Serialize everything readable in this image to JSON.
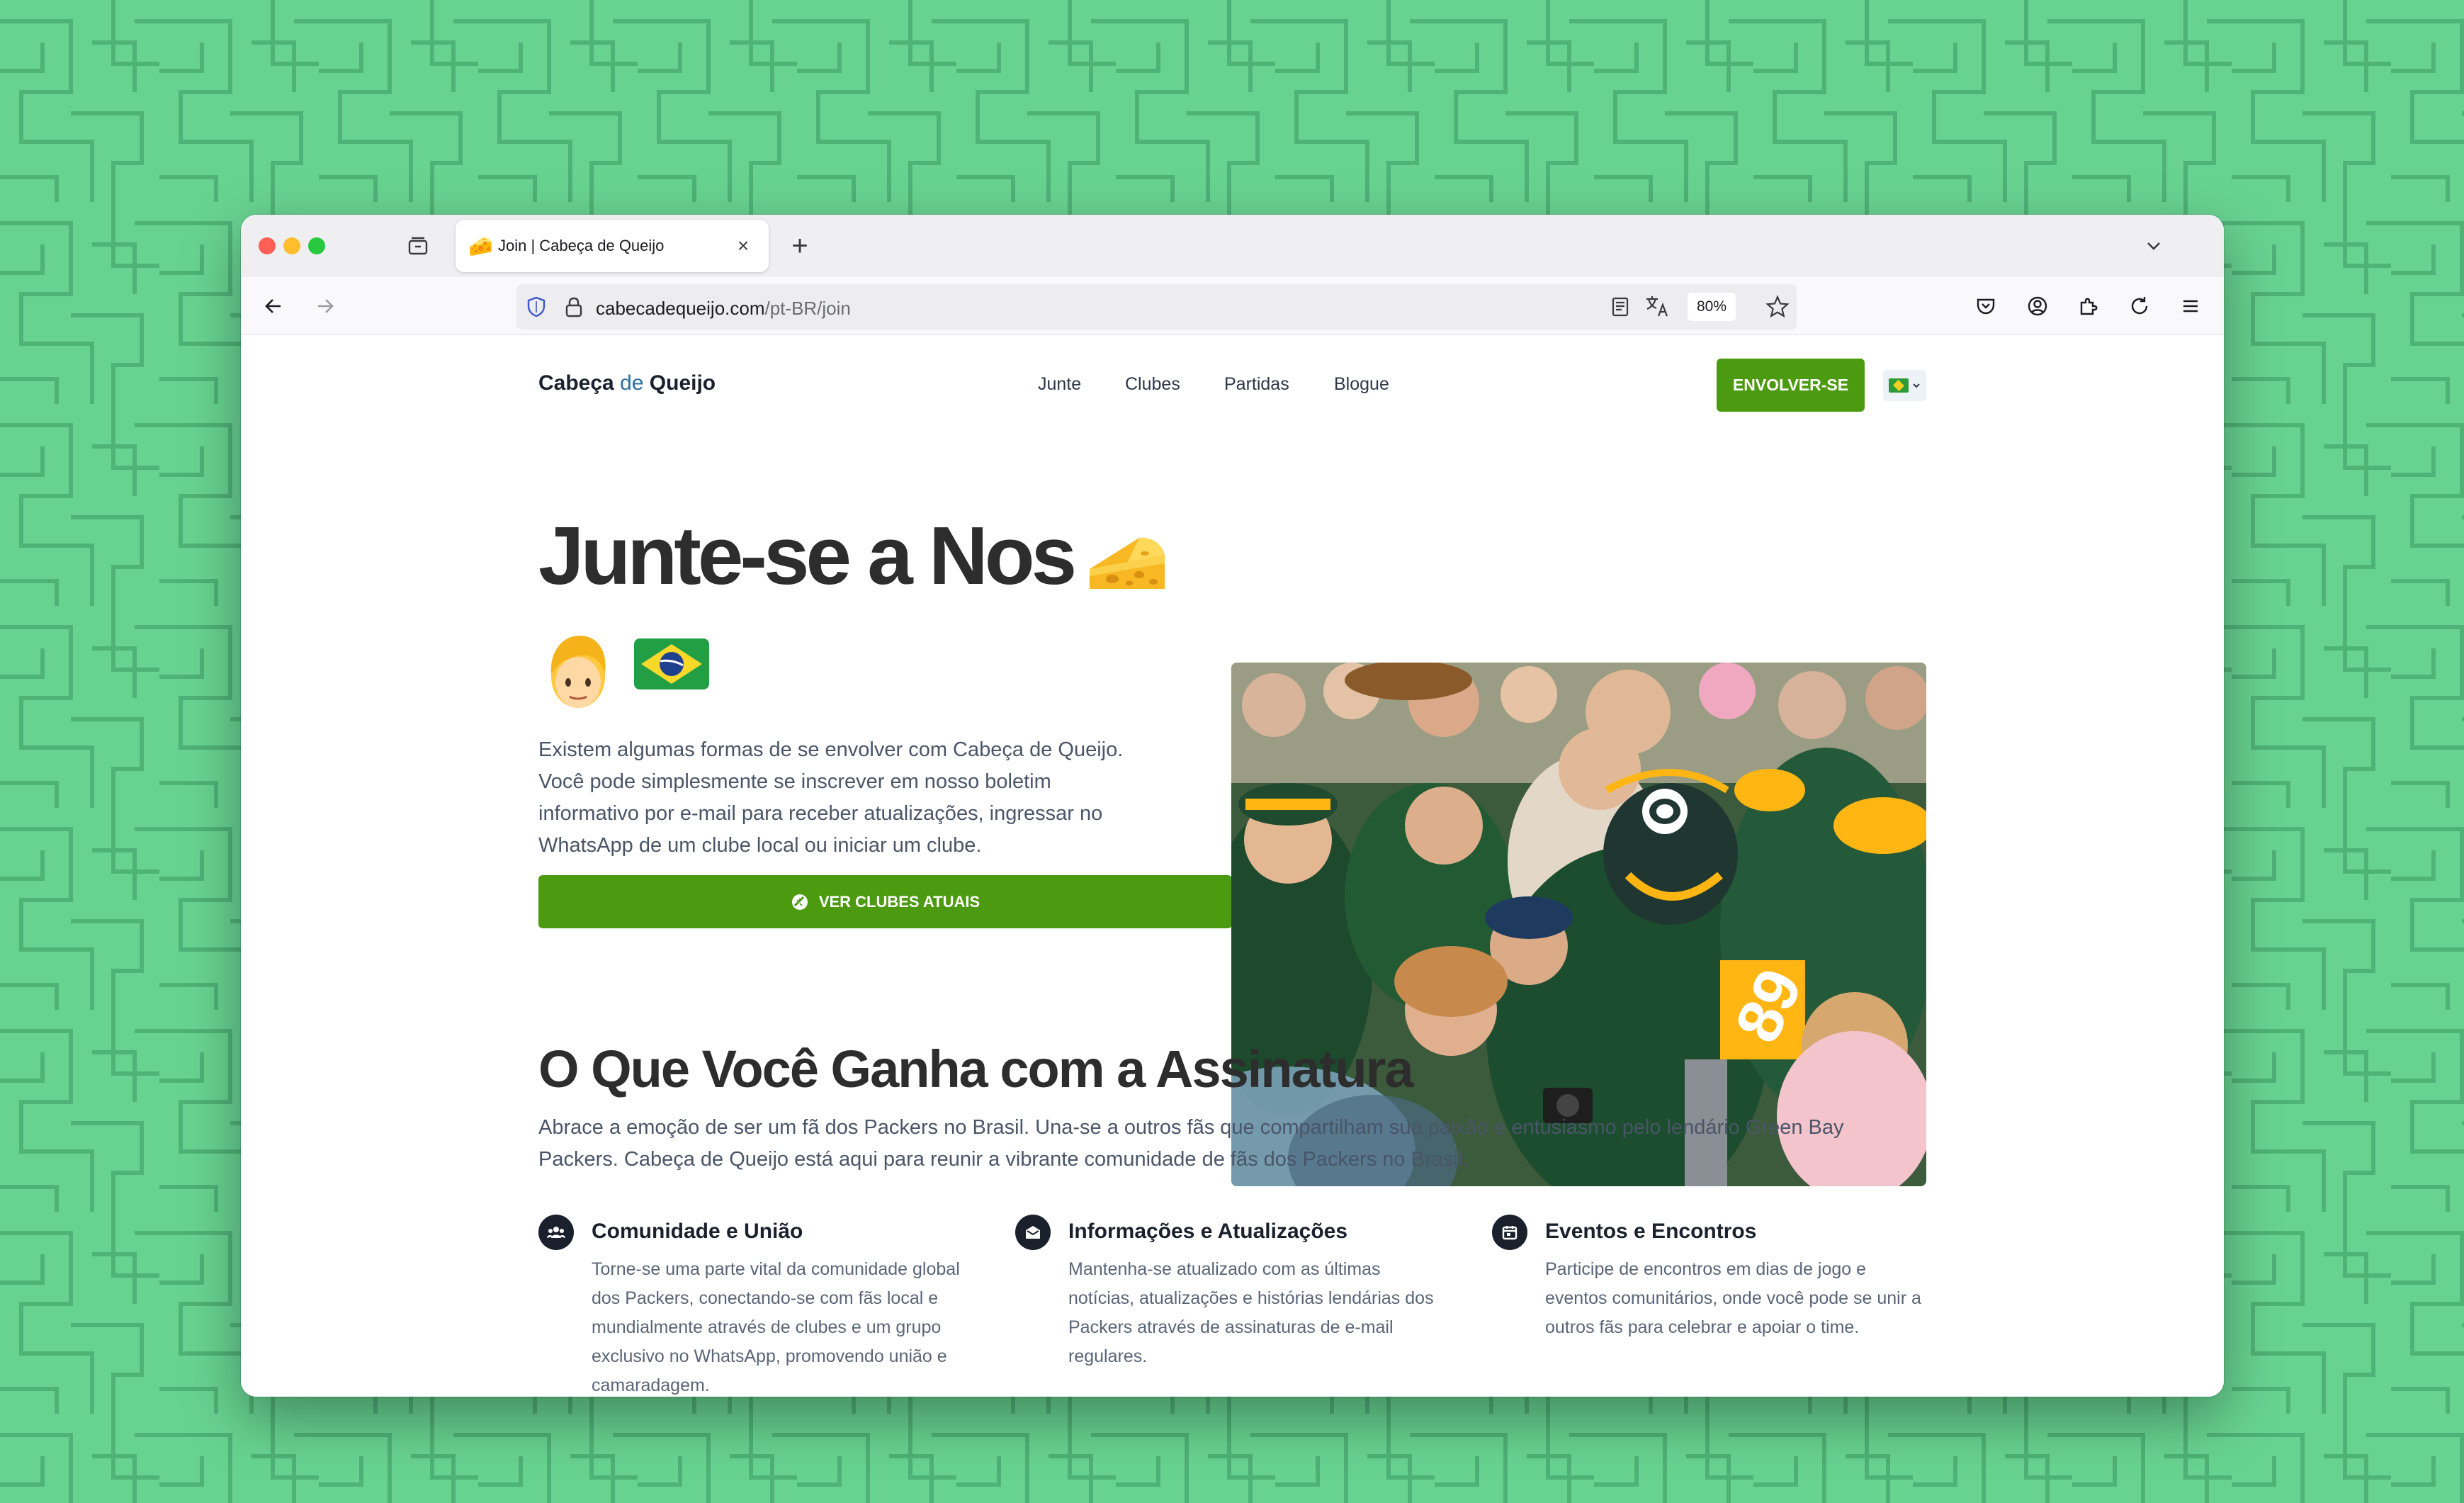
{
  "browser": {
    "tab": {
      "favicon": "🧀",
      "title": "Join | Cabeça de Queijo",
      "close": "×"
    },
    "new_tab": "+",
    "url": {
      "host": "cabecadequeijo.com",
      "path": "/pt-BR/join"
    },
    "zoom": "80%",
    "icons": {
      "back": "arrow-left-icon",
      "forward": "arrow-right-icon",
      "shield": "shield-icon",
      "lock": "lock-icon",
      "reader": "reader-view-icon",
      "translate": "translate-icon",
      "bookmark": "star-icon",
      "pocket": "pocket-icon",
      "account": "account-icon",
      "extensions": "extensions-icon",
      "reload": "reload-icon",
      "menu": "hamburger-menu-icon",
      "sidebar": "sidebar-tabs-icon",
      "tab_list": "chevron-down-icon"
    }
  },
  "site": {
    "brand": {
      "part1": "Cabeça",
      "part2": "de",
      "part3": "Queijo"
    },
    "nav": [
      "Junte",
      "Clubes",
      "Partidas",
      "Blogue"
    ],
    "cta": "ENVOLVER-SE",
    "language": "pt-BR flag"
  },
  "hero": {
    "title": "Junte-se a Nos",
    "emoji_cheese": "🧀",
    "emoji_person": "👱",
    "emoji_flag": "🇧🇷",
    "text": "Existem algumas formas de se envolver com Cabeça de Queijo. Você pode simplesmente se inscrever em nosso boletim informativo por e-mail para receber atualizações, ingressar no WhatsApp de um clube local ou iniciar um clube.",
    "button": "VER CLUBES ATUAIS",
    "button_icon": "football-icon"
  },
  "benefits": {
    "title": "O Que Você Ganha com a Assinatura",
    "text": "Abrace a emoção de ser um fã dos Packers no Brasil. Una-se a outros fãs que compartilham sua paixão e entusiasmo pelo lendário Green Bay Packers. Cabeça de Queijo está aqui para reunir a vibrante comunidade de fãs dos Packers no Brasil.",
    "features": [
      {
        "title": "Comunidade e União",
        "text": "Torne-se uma parte vital da comunidade global dos Packers, conectando-se com fãs local e mundialmente através de clubes e um grupo exclusivo no WhatsApp, promovendo união e camaradagem.",
        "icon": "people-group-icon"
      },
      {
        "title": "Informações e Atualizações",
        "text": "Mantenha-se atualizado com as últimas notícias, atualizações e histórias lendárias dos Packers através de assinaturas de e-mail regulares.",
        "icon": "envelope-icon"
      },
      {
        "title": "Eventos e Encontros",
        "text": "Participe de encontros em dias de jogo e eventos comunitários, onde você pode se unir a outros fãs para celebrar e apoiar o time.",
        "icon": "calendar-icon"
      }
    ]
  },
  "colors": {
    "background": "#68d391",
    "primary_button": "#4c9a10",
    "heading": "#2d2d2d",
    "body_text": "#4a5568",
    "packers_green": "#203731",
    "packers_gold": "#ffb612"
  }
}
